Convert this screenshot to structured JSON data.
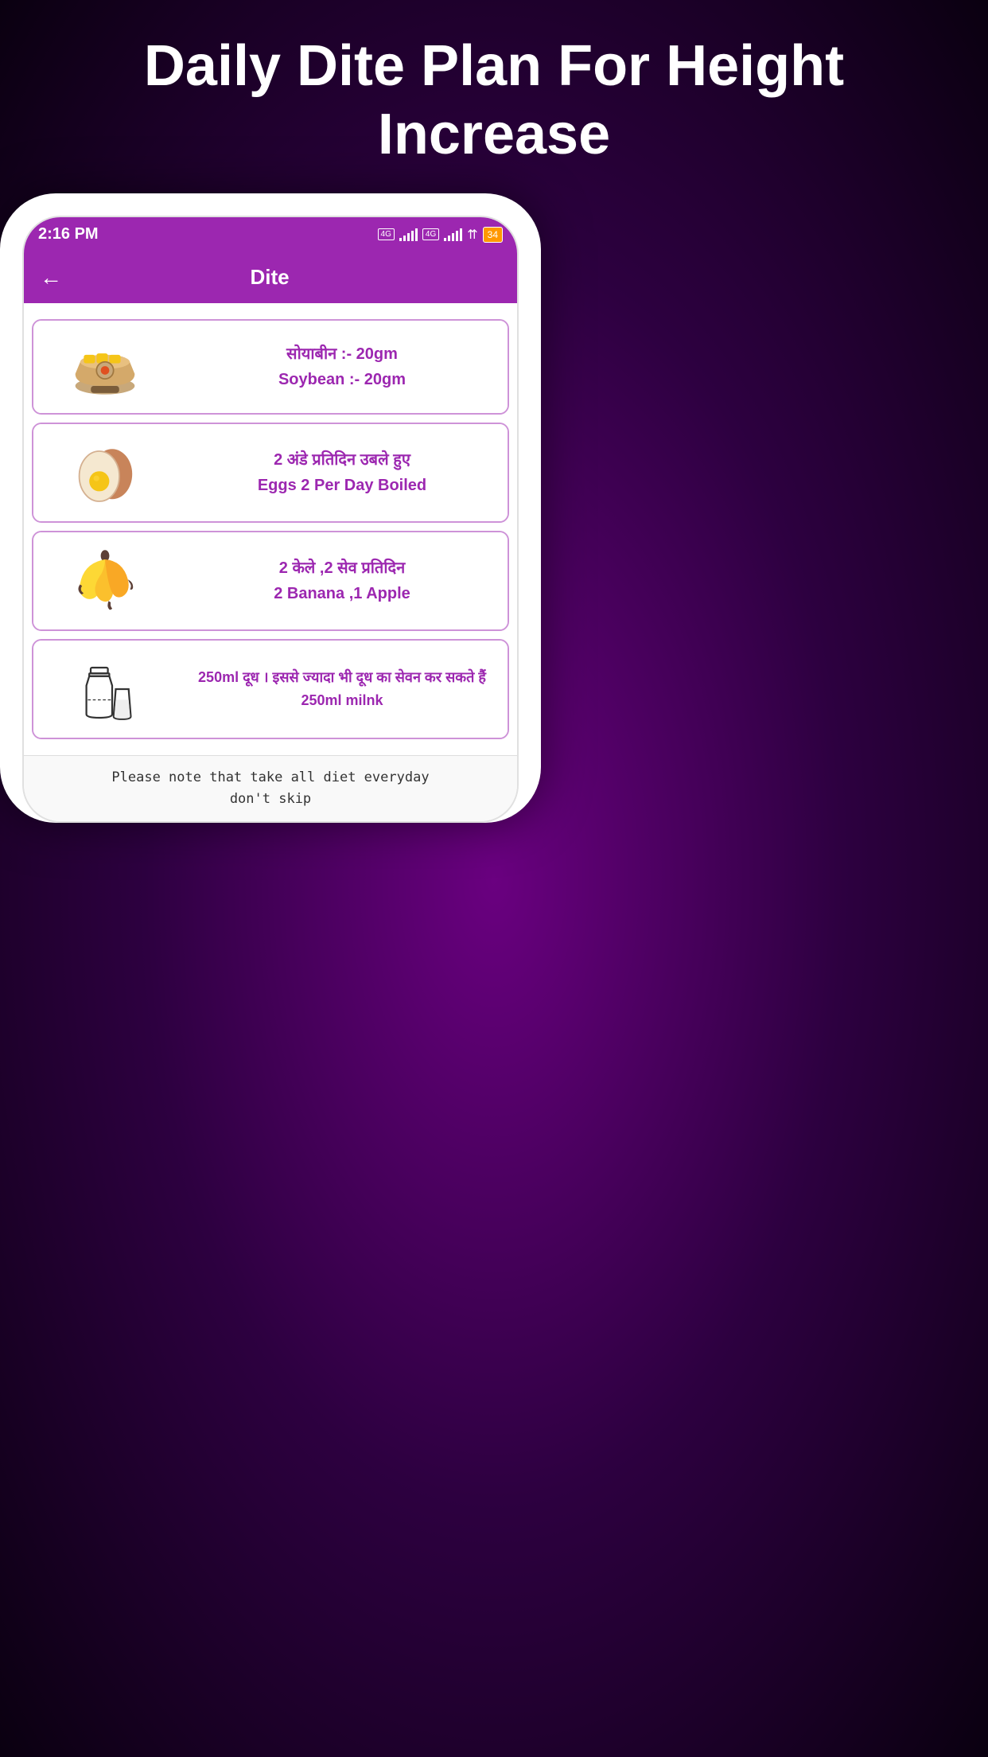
{
  "page": {
    "background_title": "Daily Dite Plan For Height Increase",
    "status_bar": {
      "time": "2:16 PM",
      "battery": "34"
    },
    "app_bar": {
      "title": "Dite",
      "back_label": "←"
    },
    "diet_cards": [
      {
        "id": "soybean",
        "icon_type": "bowl",
        "line1": "सोयाबीन  :- 20gm",
        "line2": "Soybean :- 20gm"
      },
      {
        "id": "eggs",
        "icon_type": "egg",
        "line1": "2 अंडे प्रतिदिन उबले हुए",
        "line2": "Eggs 2 Per Day Boiled"
      },
      {
        "id": "banana",
        "icon_type": "banana",
        "line1": "2 केले ,2 सेव प्रतिदिन",
        "line2": "2 Banana ,1 Apple"
      },
      {
        "id": "milk",
        "icon_type": "milk",
        "line1": "250ml दूध । इससे ज्यादा भी दूध का सेवन कर सकते हैं",
        "line2": "250ml milnk"
      }
    ],
    "footer_note_line1": "Please note that take all diet everyday",
    "footer_note_line2": "don't skip"
  }
}
